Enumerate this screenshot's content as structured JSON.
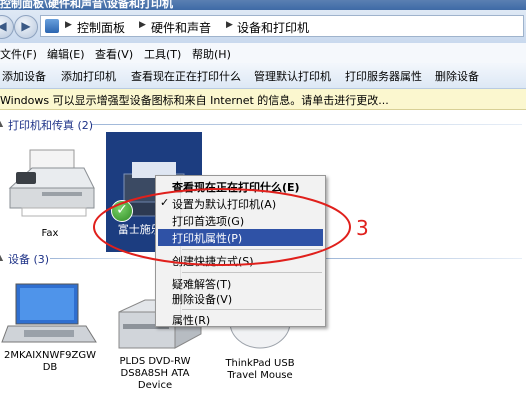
{
  "window": {
    "title": "控制面板\\硬件和声音\\设备和打印机"
  },
  "address": {
    "crumbs": [
      "控制面板",
      "硬件和声音",
      "设备和打印机"
    ],
    "separator_icon": "chevron-right-icon"
  },
  "menu": [
    "文件(F)",
    "编辑(E)",
    "查看(V)",
    "工具(T)",
    "帮助(H)"
  ],
  "toolbar": [
    "添加设备",
    "添加打印机",
    "查看现在正在打印什么",
    "管理默认打印机",
    "打印服务器属性",
    "删除设备"
  ],
  "infobar": {
    "text": "Windows 可以显示增强型设备图标和来自 Internet 的信息。请单击进行更改..."
  },
  "groups": {
    "printers": {
      "label": "打印机和传真 (2)"
    },
    "devices": {
      "label": "设备 (3)"
    }
  },
  "printers": [
    {
      "label": "Fax",
      "icon": "fax-printer-icon"
    },
    {
      "label": "富士施乐 ... 印",
      "icon": "printer-icon",
      "selected": true,
      "default": true
    }
  ],
  "devices": [
    {
      "label_lines": [
        "2MKAIXNWF9ZGW",
        "DB"
      ],
      "icon": "laptop-icon"
    },
    {
      "label_lines": [
        "PLDS DVD-RW",
        "DS8A8SH ATA",
        "Device"
      ],
      "icon": "dvd-drive-icon"
    },
    {
      "label_lines": [
        "ThinkPad USB",
        "Travel Mouse"
      ],
      "icon": "mouse-icon"
    }
  ],
  "context_menu": {
    "items": [
      {
        "label": "查看现在正在打印什么(E)",
        "bold": true
      },
      {
        "label": "设置为默认打印机(A)",
        "checked": true
      },
      {
        "label": "打印首选项(G)"
      },
      {
        "label": "打印机属性(P)",
        "highlighted": true
      },
      {
        "label": "创建快捷方式(S)"
      },
      {
        "label": "疑难解答(T)"
      },
      {
        "label": "删除设备(V)"
      },
      {
        "label": "属性(R)"
      }
    ]
  },
  "annotation": {
    "text": "3",
    "color": "#e0201c"
  },
  "colors": {
    "selection": "#1c3d80",
    "menu_highlight": "#2f52a6",
    "group_label": "#1e3287"
  }
}
